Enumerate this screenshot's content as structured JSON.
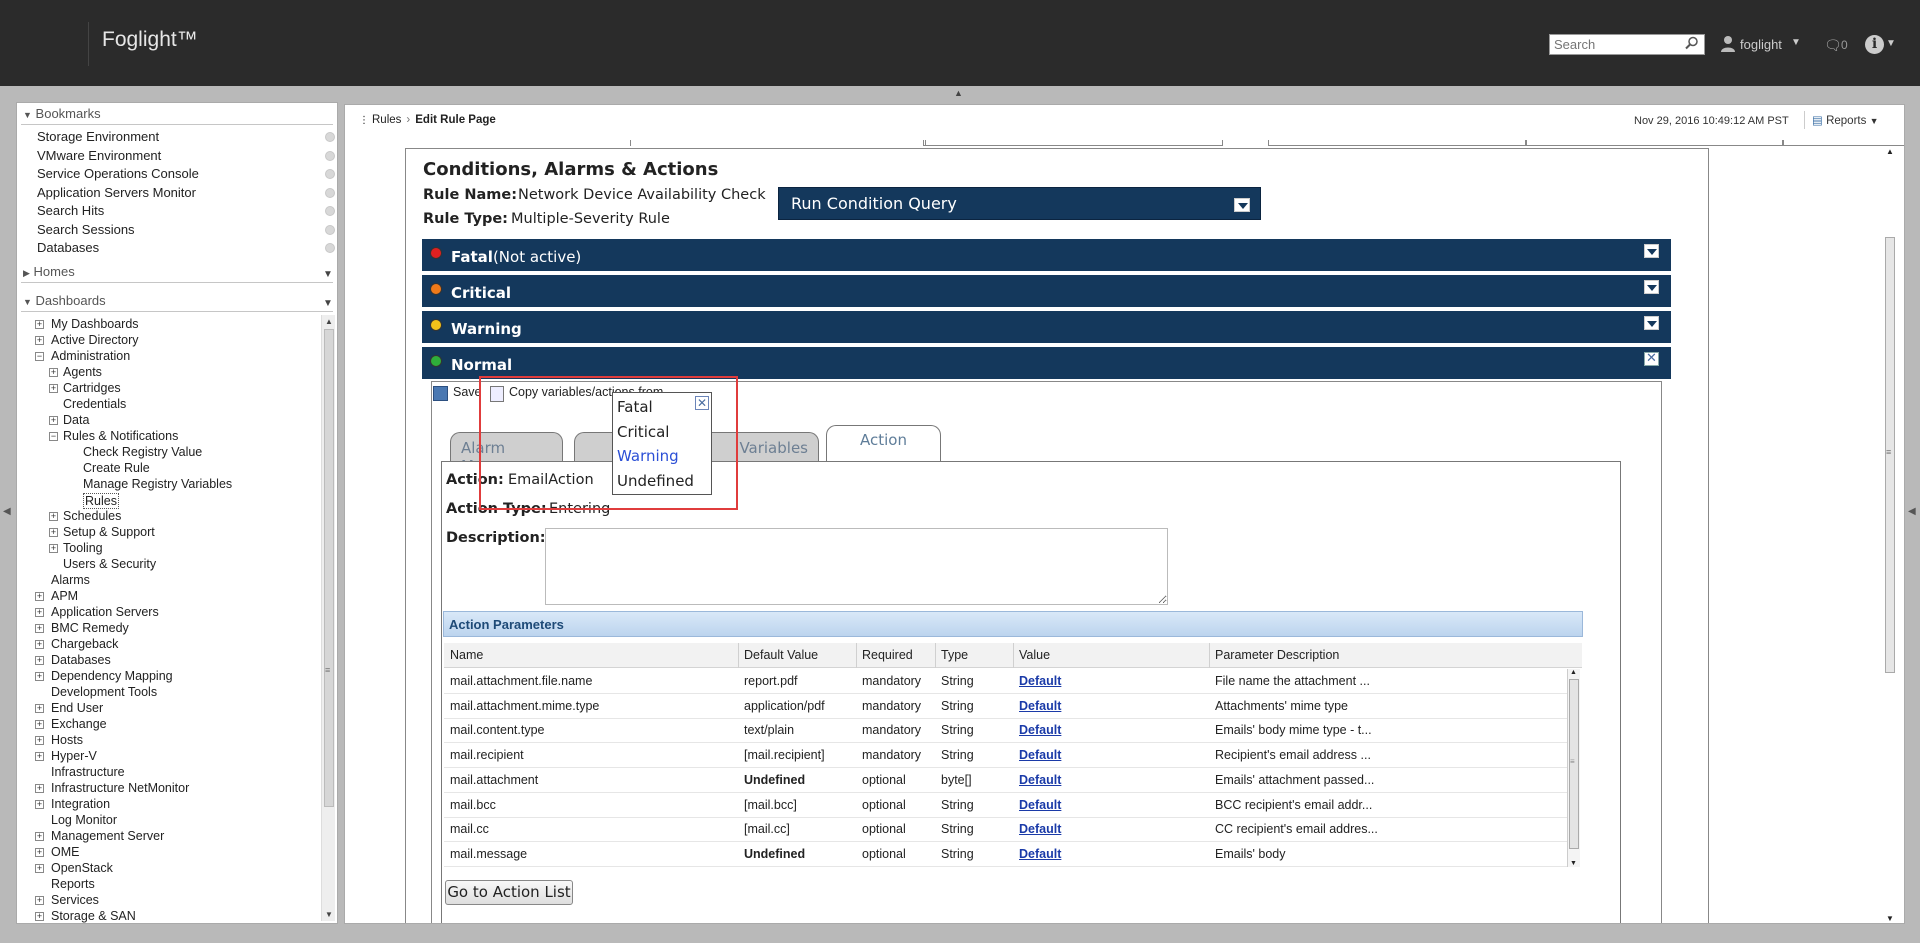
{
  "header": {
    "brand": "Foglight™",
    "search_placeholder": "Search",
    "user": "foglight",
    "messages_count": "0"
  },
  "bookmarks": {
    "title": "Bookmarks",
    "items": [
      "Storage Environment",
      "VMware Environment",
      "Service Operations Console",
      "Application Servers Monitor",
      "Search Hits",
      "Search Sessions",
      "Databases"
    ]
  },
  "homes": {
    "title": "Homes"
  },
  "dashboards": {
    "title": "Dashboards",
    "tree": [
      {
        "label": "My Dashboards",
        "level": 0,
        "expander": "+"
      },
      {
        "label": "Active Directory",
        "level": 0,
        "expander": "+"
      },
      {
        "label": "Administration",
        "level": 0,
        "expander": "-"
      },
      {
        "label": "Agents",
        "level": 1,
        "expander": "+"
      },
      {
        "label": "Cartridges",
        "level": 1,
        "expander": "+"
      },
      {
        "label": "Credentials",
        "level": 1,
        "expander": ""
      },
      {
        "label": "Data",
        "level": 1,
        "expander": "+"
      },
      {
        "label": "Rules & Notifications",
        "level": 1,
        "expander": "-"
      },
      {
        "label": "Check Registry Value",
        "level": 2,
        "expander": ""
      },
      {
        "label": "Create Rule",
        "level": 2,
        "expander": ""
      },
      {
        "label": "Manage Registry Variables",
        "level": 2,
        "expander": ""
      },
      {
        "label": "Rules",
        "level": 2,
        "expander": "",
        "selected": true
      },
      {
        "label": "Schedules",
        "level": 1,
        "expander": "+"
      },
      {
        "label": "Setup & Support",
        "level": 1,
        "expander": "+"
      },
      {
        "label": "Tooling",
        "level": 1,
        "expander": "+"
      },
      {
        "label": "Users & Security",
        "level": 1,
        "expander": ""
      },
      {
        "label": "Alarms",
        "level": 0,
        "expander": ""
      },
      {
        "label": "APM",
        "level": 0,
        "expander": "+"
      },
      {
        "label": "Application Servers",
        "level": 0,
        "expander": "+"
      },
      {
        "label": "BMC Remedy",
        "level": 0,
        "expander": "+"
      },
      {
        "label": "Chargeback",
        "level": 0,
        "expander": "+"
      },
      {
        "label": "Databases",
        "level": 0,
        "expander": "+"
      },
      {
        "label": "Dependency Mapping",
        "level": 0,
        "expander": "+"
      },
      {
        "label": "Development Tools",
        "level": 0,
        "expander": ""
      },
      {
        "label": "End User",
        "level": 0,
        "expander": "+"
      },
      {
        "label": "Exchange",
        "level": 0,
        "expander": "+"
      },
      {
        "label": "Hosts",
        "level": 0,
        "expander": "+"
      },
      {
        "label": "Hyper-V",
        "level": 0,
        "expander": "+"
      },
      {
        "label": "Infrastructure",
        "level": 0,
        "expander": ""
      },
      {
        "label": "Infrastructure NetMonitor",
        "level": 0,
        "expander": "+"
      },
      {
        "label": "Integration",
        "level": 0,
        "expander": "+"
      },
      {
        "label": "Log Monitor",
        "level": 0,
        "expander": ""
      },
      {
        "label": "Management Server",
        "level": 0,
        "expander": "+"
      },
      {
        "label": "OME",
        "level": 0,
        "expander": "+"
      },
      {
        "label": "OpenStack",
        "level": 0,
        "expander": "+"
      },
      {
        "label": "Reports",
        "level": 0,
        "expander": ""
      },
      {
        "label": "Services",
        "level": 0,
        "expander": "+"
      },
      {
        "label": "Storage & SAN",
        "level": 0,
        "expander": "+"
      }
    ]
  },
  "breadcrumb": {
    "parent": "Rules",
    "current": "Edit Rule Page"
  },
  "timestamp": "Nov 29, 2016 10:49:12 AM PST",
  "reports_label": "Reports",
  "main": {
    "title": "Conditions, Alarms & Actions",
    "rule_name_label": "Rule Name:",
    "rule_name": "Network Device Availability Check",
    "rule_type_label": "Rule Type:",
    "rule_type": "Multiple-Severity Rule",
    "run_condition_query": "Run Condition Query",
    "severities": [
      {
        "label": "Fatal",
        "extra": "(Not active)",
        "color": "#e02020"
      },
      {
        "label": "Critical",
        "extra": "",
        "color": "#f07a1a"
      },
      {
        "label": "Warning",
        "extra": "",
        "color": "#f2c21a"
      },
      {
        "label": "Normal",
        "extra": "",
        "color": "#2fae3a"
      }
    ],
    "toolbar": {
      "save": "Save",
      "copy": "Copy variables/actions from"
    },
    "tabs": [
      "Alarm Message",
      "Variables",
      "Action"
    ],
    "action_label": "Action:",
    "action_value": "EmailAction",
    "action_type_label": "Action Type:",
    "action_type_value": "Entering",
    "description_label": "Description:",
    "params_title": "Action Parameters",
    "columns": [
      "Name",
      "Default Value",
      "Required",
      "Type",
      "Value",
      "Parameter Description"
    ],
    "rows": [
      {
        "name": "mail.attachment.file.name",
        "default": "report.pdf",
        "required": "mandatory",
        "type": "String",
        "value": "Default",
        "desc": "File name the attachment ..."
      },
      {
        "name": "mail.attachment.mime.type",
        "default": "application/pdf",
        "required": "mandatory",
        "type": "String",
        "value": "Default",
        "desc": "Attachments' mime type"
      },
      {
        "name": "mail.content.type",
        "default": "text/plain",
        "required": "mandatory",
        "type": "String",
        "value": "Default",
        "desc": "Emails' body mime type - t..."
      },
      {
        "name": "mail.recipient",
        "default": "[mail.recipient]",
        "required": "mandatory",
        "type": "String",
        "value": "Default",
        "desc": "Recipient's email address ..."
      },
      {
        "name": "mail.attachment",
        "default": "Undefined",
        "required": "optional",
        "type": "byte[]",
        "value": "Default",
        "desc": "Emails' attachment passed..."
      },
      {
        "name": "mail.bcc",
        "default": "[mail.bcc]",
        "required": "optional",
        "type": "String",
        "value": "Default",
        "desc": "BCC recipient's email addr..."
      },
      {
        "name": "mail.cc",
        "default": "[mail.cc]",
        "required": "optional",
        "type": "String",
        "value": "Default",
        "desc": "CC recipient's email addres..."
      },
      {
        "name": "mail.message",
        "default": "Undefined",
        "required": "optional",
        "type": "String",
        "value": "Default",
        "desc": "Emails' body"
      }
    ],
    "go_button": "Go to Action List"
  },
  "popup": {
    "items": [
      "Fatal",
      "Critical",
      "Warning",
      "Undefined"
    ],
    "highlighted": "Warning"
  }
}
